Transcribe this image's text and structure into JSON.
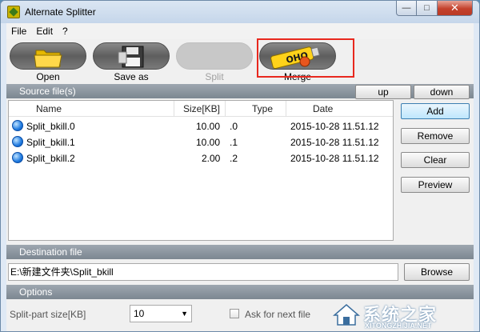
{
  "window": {
    "title": "Alternate Splitter"
  },
  "menu": {
    "items": [
      "File",
      "Edit",
      "?"
    ]
  },
  "toolbar": {
    "open": "Open",
    "save_as": "Save as",
    "split": "Split",
    "merge": "Merge",
    "merge_tube_text": "OHO"
  },
  "sources": {
    "header": "Source file(s)",
    "up": "up",
    "down": "down",
    "columns": {
      "name": "Name",
      "size": "Size[KB]",
      "type": "Type",
      "date": "Date"
    },
    "rows": [
      {
        "name": "Split_bkill.0",
        "size": "10.00",
        "type": ".0",
        "date": "2015-10-28 11.51.12"
      },
      {
        "name": "Split_bkill.1",
        "size": "10.00",
        "type": ".1",
        "date": "2015-10-28 11.51.12"
      },
      {
        "name": "Split_bkill.2",
        "size": "2.00",
        "type": ".2",
        "date": "2015-10-28 11.51.12"
      }
    ]
  },
  "actions": {
    "add": "Add",
    "remove": "Remove",
    "clear": "Clear",
    "preview": "Preview"
  },
  "destination": {
    "header": "Destination file",
    "value": "E:\\新建文件夹\\Split_bkill",
    "browse": "Browse"
  },
  "options": {
    "header": "Options",
    "split_size_label": "Split-part size[KB]",
    "split_size_value": "10",
    "ask_next_label": "Ask for next file"
  },
  "watermark": {
    "main": "系统之家",
    "sub": "XITONGZHIJIA.NET"
  },
  "colors": {
    "highlight": "#e8281e",
    "section_bar": "#8a949e",
    "selection": "#3c7fb1"
  }
}
